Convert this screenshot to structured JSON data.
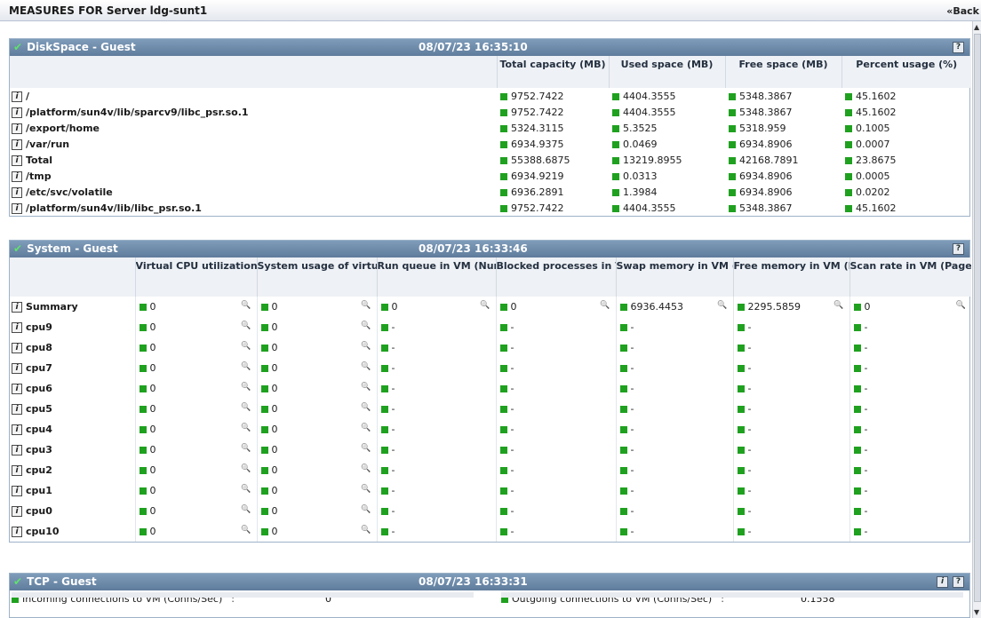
{
  "header": {
    "title": "MEASURES FOR Server ldg-sunt1",
    "back_label": "«Back"
  },
  "diskspace": {
    "title": "DiskSpace - Guest",
    "timestamp": "08/07/23 16:35:10",
    "help_icon": "?",
    "columns": [
      "Total capacity (MB)",
      "Used space (MB)",
      "Free space (MB)",
      "Percent usage (%)"
    ],
    "rows": [
      {
        "label": "/",
        "values": [
          "9752.7422",
          "4404.3555",
          "5348.3867",
          "45.1602"
        ]
      },
      {
        "label": "/platform/sun4v/lib/sparcv9/libc_psr.so.1",
        "values": [
          "9752.7422",
          "4404.3555",
          "5348.3867",
          "45.1602"
        ]
      },
      {
        "label": "/export/home",
        "values": [
          "5324.3115",
          "5.3525",
          "5318.959",
          "0.1005"
        ]
      },
      {
        "label": "/var/run",
        "values": [
          "6934.9375",
          "0.0469",
          "6934.8906",
          "0.0007"
        ]
      },
      {
        "label": "Total",
        "values": [
          "55388.6875",
          "13219.8955",
          "42168.7891",
          "23.8675"
        ]
      },
      {
        "label": "/tmp",
        "values": [
          "6934.9219",
          "0.0313",
          "6934.8906",
          "0.0005"
        ]
      },
      {
        "label": "/etc/svc/volatile",
        "values": [
          "6936.2891",
          "1.3984",
          "6934.8906",
          "0.0202"
        ]
      },
      {
        "label": "/platform/sun4v/lib/libc_psr.so.1",
        "values": [
          "9752.7422",
          "4404.3555",
          "5348.3867",
          "45.1602"
        ]
      }
    ]
  },
  "system": {
    "title": "System - Guest",
    "timestamp": "08/07/23 16:33:46",
    "help_icon": "?",
    "columns": [
      "Virtual CPU utilization (%)",
      "System usage of virtual CPU (%)",
      "Run queue in VM (Number)",
      "Blocked processes in VM (Number)",
      "Swap memory in VM (MB)",
      "Free memory in VM (MB)",
      "Scan rate in VM (Pages/Sec)"
    ],
    "rows": [
      {
        "label": "Summary",
        "values": [
          "0",
          "0",
          "0",
          "0",
          "6936.4453",
          "2295.5859",
          "0"
        ],
        "mag": [
          true,
          true,
          true,
          true,
          true,
          true,
          true
        ]
      },
      {
        "label": "cpu9",
        "values": [
          "0",
          "0",
          "-",
          "-",
          "-",
          "-",
          "-"
        ],
        "mag": [
          true,
          true,
          false,
          false,
          false,
          false,
          false
        ]
      },
      {
        "label": "cpu8",
        "values": [
          "0",
          "0",
          "-",
          "-",
          "-",
          "-",
          "-"
        ],
        "mag": [
          true,
          true,
          false,
          false,
          false,
          false,
          false
        ]
      },
      {
        "label": "cpu7",
        "values": [
          "0",
          "0",
          "-",
          "-",
          "-",
          "-",
          "-"
        ],
        "mag": [
          true,
          true,
          false,
          false,
          false,
          false,
          false
        ]
      },
      {
        "label": "cpu6",
        "values": [
          "0",
          "0",
          "-",
          "-",
          "-",
          "-",
          "-"
        ],
        "mag": [
          true,
          true,
          false,
          false,
          false,
          false,
          false
        ]
      },
      {
        "label": "cpu5",
        "values": [
          "0",
          "0",
          "-",
          "-",
          "-",
          "-",
          "-"
        ],
        "mag": [
          true,
          true,
          false,
          false,
          false,
          false,
          false
        ]
      },
      {
        "label": "cpu4",
        "values": [
          "0",
          "0",
          "-",
          "-",
          "-",
          "-",
          "-"
        ],
        "mag": [
          true,
          true,
          false,
          false,
          false,
          false,
          false
        ]
      },
      {
        "label": "cpu3",
        "values": [
          "0",
          "0",
          "-",
          "-",
          "-",
          "-",
          "-"
        ],
        "mag": [
          true,
          true,
          false,
          false,
          false,
          false,
          false
        ]
      },
      {
        "label": "cpu2",
        "values": [
          "0",
          "0",
          "-",
          "-",
          "-",
          "-",
          "-"
        ],
        "mag": [
          true,
          true,
          false,
          false,
          false,
          false,
          false
        ]
      },
      {
        "label": "cpu1",
        "values": [
          "0",
          "0",
          "-",
          "-",
          "-",
          "-",
          "-"
        ],
        "mag": [
          true,
          true,
          false,
          false,
          false,
          false,
          false
        ]
      },
      {
        "label": "cpu0",
        "values": [
          "0",
          "0",
          "-",
          "-",
          "-",
          "-",
          "-"
        ],
        "mag": [
          true,
          true,
          false,
          false,
          false,
          false,
          false
        ]
      },
      {
        "label": "cpu10",
        "values": [
          "0",
          "0",
          "-",
          "-",
          "-",
          "-",
          "-"
        ],
        "mag": [
          true,
          true,
          false,
          false,
          false,
          false,
          false
        ]
      }
    ]
  },
  "tcp": {
    "title": "TCP - Guest",
    "timestamp": "08/07/23 16:33:31",
    "info_icon": "i",
    "help_icon": "?",
    "metrics": [
      {
        "label": "Incoming connections to VM (Conns/Sec)",
        "separator": ":",
        "value": "0"
      },
      {
        "label": "Outgoing connections to VM (Conns/Sec)",
        "separator": ":",
        "value": "0.1558"
      }
    ]
  },
  "colors": {
    "panel_header": "#6f8cab",
    "status_green": "#1fa11f",
    "check_green": "#5fe26a"
  },
  "icons": {
    "info_button": "info-icon",
    "zoom": "magnifier-icon",
    "status": "status-square-icon",
    "check": "check-icon"
  }
}
